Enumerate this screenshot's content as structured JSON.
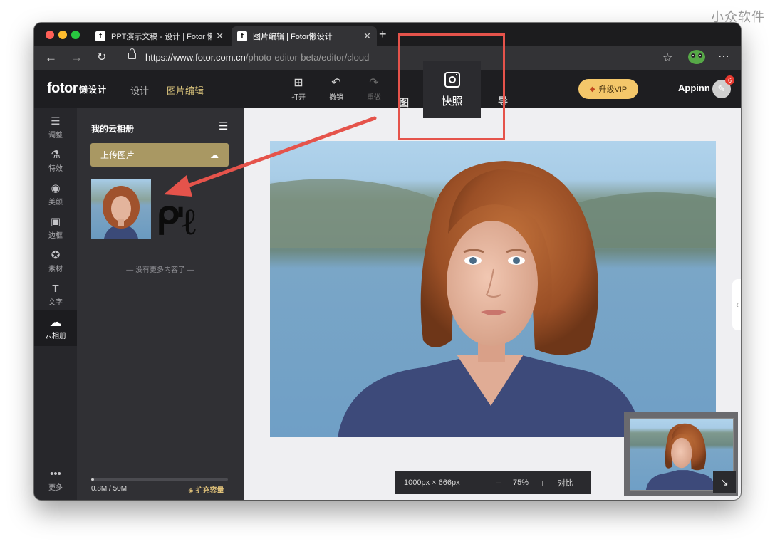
{
  "watermark": "小众软件",
  "browser": {
    "tabs": [
      {
        "label": "PPT演示文稿 - 设计 | Fotor 懒设",
        "active": false
      },
      {
        "label": "图片编辑 | Fotor懒设计",
        "active": true
      }
    ],
    "url_domain": "https://www.fotor.com.cn",
    "url_path": "/photo-editor-beta/editor/cloud"
  },
  "header": {
    "logo": "fotor",
    "logo_cn": "懒设计",
    "nav": [
      "设计",
      "图片编辑"
    ],
    "tools": {
      "open": "打开",
      "undo": "撤销",
      "redo": "重做"
    },
    "tool_edge": "图",
    "snapshot": "快照",
    "snapshot_edge": "导",
    "vip": "升级VIP",
    "user": "Appinn",
    "notification_count": "6"
  },
  "sidebar": {
    "items": [
      {
        "label": "调整",
        "icon": "sliders-icon"
      },
      {
        "label": "特效",
        "icon": "flask-icon"
      },
      {
        "label": "美颜",
        "icon": "eye-icon"
      },
      {
        "label": "边框",
        "icon": "frame-icon"
      },
      {
        "label": "素材",
        "icon": "star-icon"
      },
      {
        "label": "文字",
        "icon": "text-icon"
      },
      {
        "label": "云相册",
        "icon": "cloud-upload-icon",
        "active": true
      },
      {
        "label": "更多",
        "icon": "more-icon"
      }
    ]
  },
  "panel": {
    "title": "我的云相册",
    "upload": "上传图片",
    "no_more": "— 没有更多内容了 —",
    "storage_used": "0.8M",
    "storage_total": "50M",
    "storage_fraction": 0.016,
    "expand": "扩充容量"
  },
  "canvas": {
    "dimensions": "1000px × 666px",
    "zoom": "75%",
    "compare": "对比"
  },
  "colors": {
    "accent_gold": "#a99863",
    "vip": "#f4c76a",
    "annotation_red": "#e5534b"
  }
}
